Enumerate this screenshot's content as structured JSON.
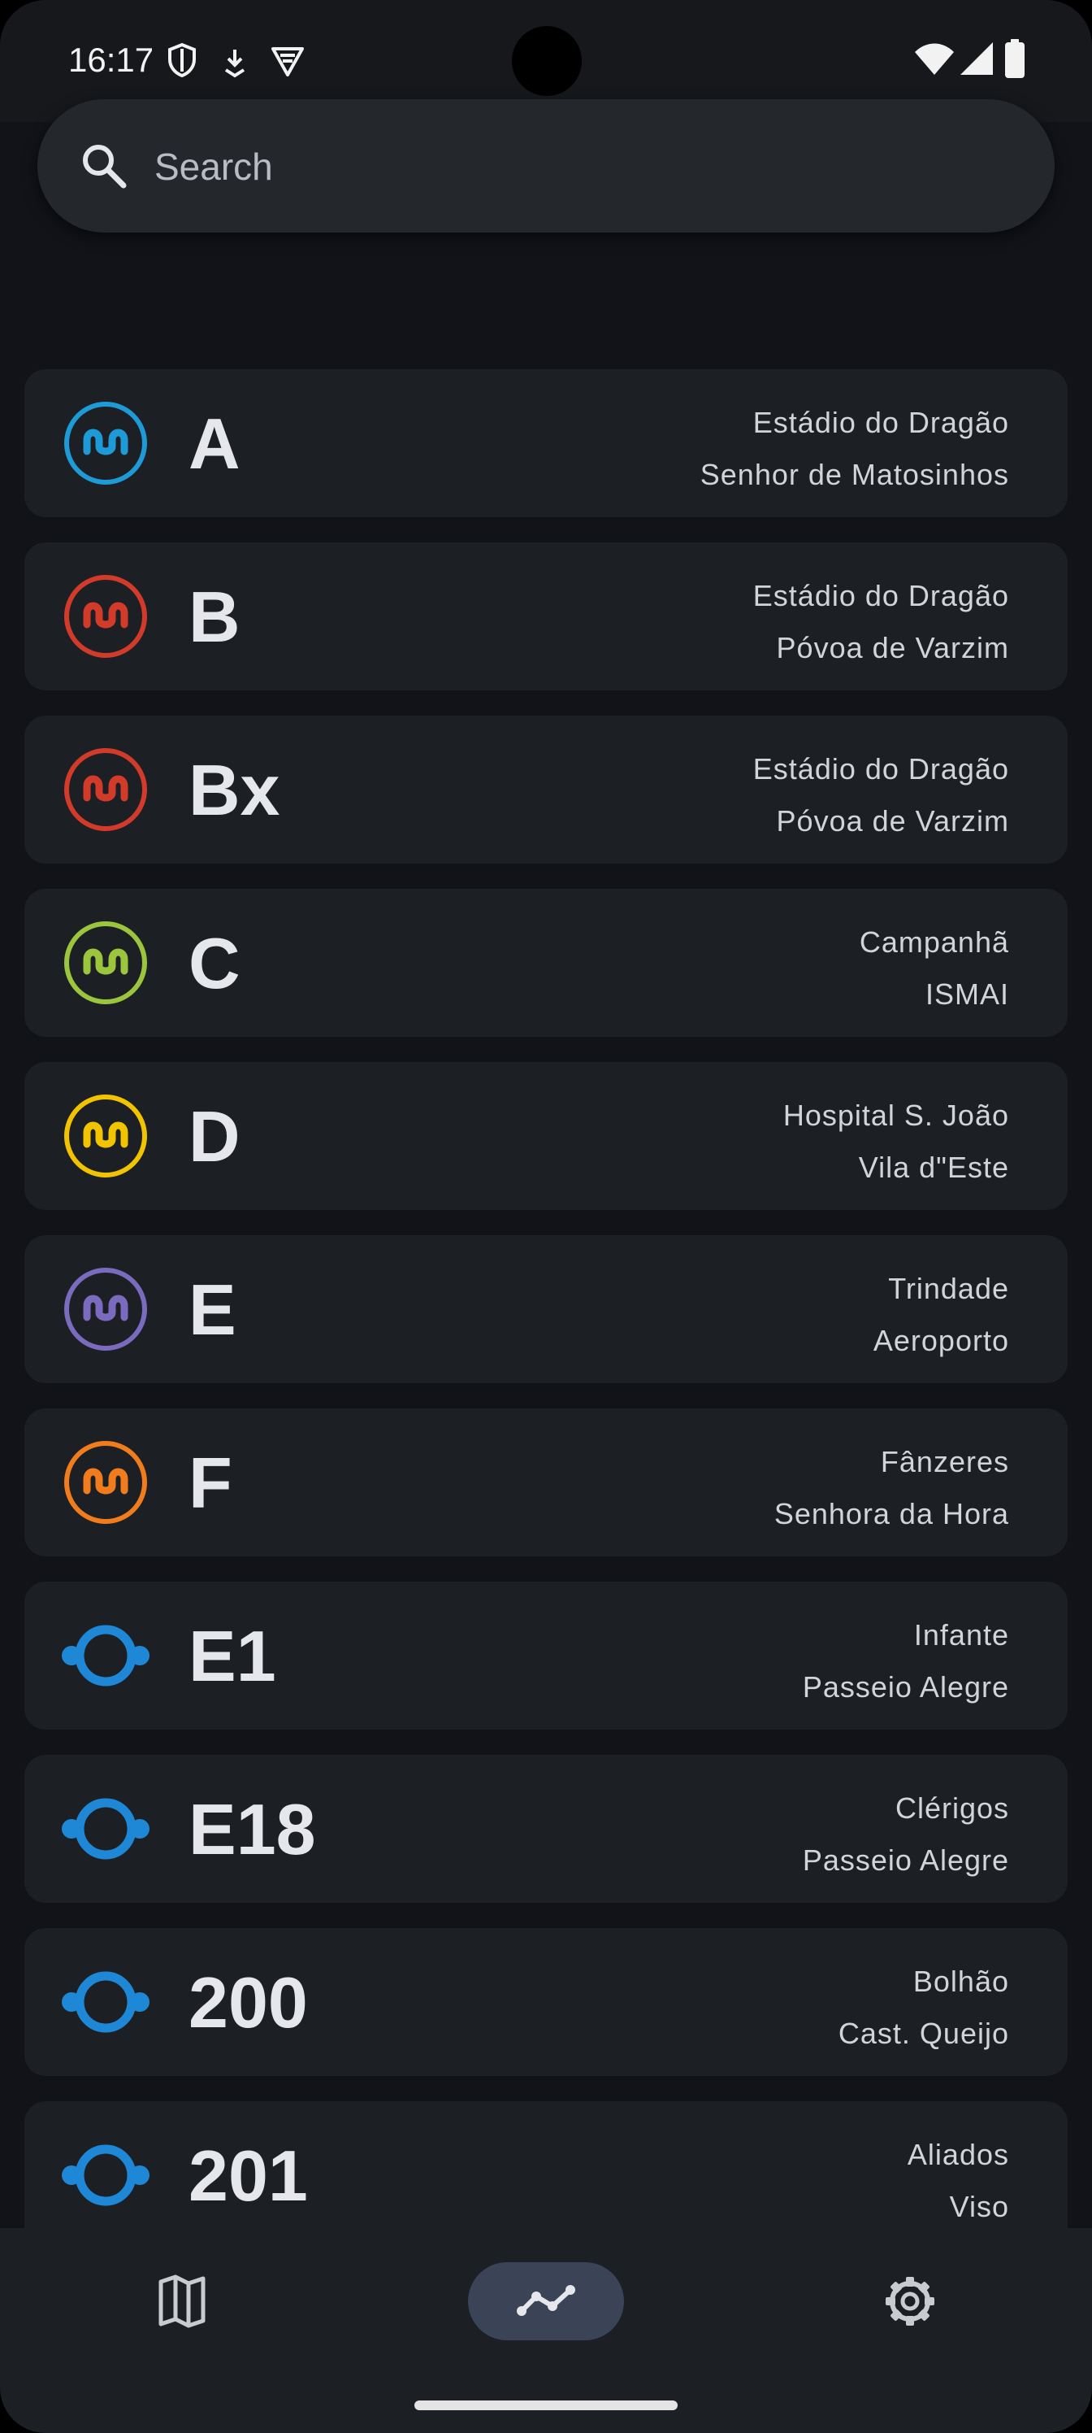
{
  "status_bar": {
    "time": "16:17",
    "left_icons": [
      "shield-icon",
      "download-icon",
      "vpn-shield-icon"
    ],
    "right_icons": [
      "wifi-icon",
      "signal-icon",
      "battery-icon"
    ]
  },
  "search": {
    "placeholder": "Search",
    "value": ""
  },
  "lines": [
    {
      "name": "A",
      "kind": "metro",
      "color": "#1e9bd7",
      "stops": [
        "Estádio do Dragão",
        "Senhor de Matosinhos"
      ]
    },
    {
      "name": "B",
      "kind": "metro",
      "color": "#d23a2a",
      "stops": [
        "Estádio do Dragão",
        "Póvoa de Varzim"
      ]
    },
    {
      "name": "Bx",
      "kind": "metro",
      "color": "#d23a2a",
      "stops": [
        "Estádio do Dragão",
        "Póvoa de Varzim"
      ]
    },
    {
      "name": "C",
      "kind": "metro",
      "color": "#9bc53d",
      "stops": [
        "Campanhã",
        "ISMAI"
      ]
    },
    {
      "name": "D",
      "kind": "metro",
      "color": "#f2c300",
      "stops": [
        "Hospital S. João",
        "Vila d\"Este"
      ]
    },
    {
      "name": "E",
      "kind": "metro",
      "color": "#7a6bbf",
      "stops": [
        "Trindade",
        "Aeroporto"
      ]
    },
    {
      "name": "F",
      "kind": "metro",
      "color": "#f07c1e",
      "stops": [
        "Fânzeres",
        "Senhora da Hora"
      ]
    },
    {
      "name": "E1",
      "kind": "bus",
      "color": "#1e88d6",
      "stops": [
        "Infante",
        "Passeio Alegre"
      ]
    },
    {
      "name": "E18",
      "kind": "bus",
      "color": "#1e88d6",
      "stops": [
        "Clérigos",
        "Passeio Alegre"
      ]
    },
    {
      "name": "200",
      "kind": "bus",
      "color": "#1e88d6",
      "stops": [
        "Bolhão",
        "Cast. Queijo"
      ]
    },
    {
      "name": "201",
      "kind": "bus",
      "color": "#1e88d6",
      "stops": [
        "Aliados",
        "Viso"
      ]
    }
  ],
  "nav": {
    "items": [
      {
        "icon": "map-icon",
        "active": false
      },
      {
        "icon": "route-lines-icon",
        "active": true
      },
      {
        "icon": "settings-gear-icon",
        "active": false
      }
    ],
    "active_color": "#3a4456"
  }
}
